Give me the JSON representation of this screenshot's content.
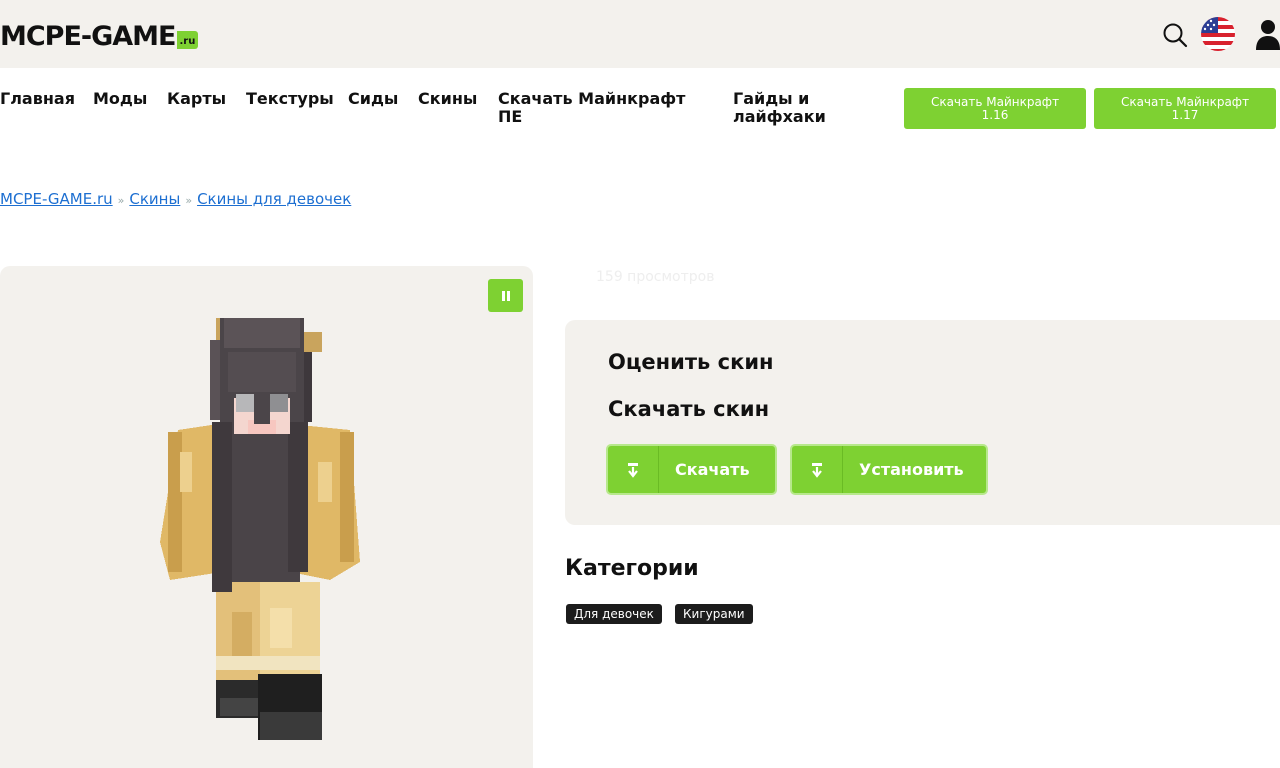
{
  "header": {
    "logo_text": "MCPE-GAME",
    "logo_suffix": ".ru",
    "icons": [
      "search-icon",
      "us-flag-icon",
      "user-icon"
    ]
  },
  "nav": {
    "items": [
      {
        "label": "Главная"
      },
      {
        "label": "Моды"
      },
      {
        "label": "Карты"
      },
      {
        "label": "Текстуры"
      },
      {
        "label": "Сиды"
      },
      {
        "label": "Скины"
      },
      {
        "label": "Скачать Майнкрафт\nПЕ"
      },
      {
        "label": "Гайды и\nлайфхаки"
      }
    ],
    "download_buttons": [
      {
        "label": "Скачать Майнкрафт\n1.16"
      },
      {
        "label": "Скачать Майнкрафт\n1.17"
      }
    ]
  },
  "breadcrumb": {
    "items": [
      "MCPE-GAME.ru",
      "Скины",
      "Скины для девочек"
    ],
    "separator": "»"
  },
  "skin": {
    "views": "159 просмотров"
  },
  "panel": {
    "rate_title": "Оценить скин",
    "download_title": "Скачать скин",
    "download_label": "Скачать",
    "install_label": "Установить"
  },
  "categories": {
    "title": "Категории",
    "tags": [
      "Для девочек",
      "Кигурами"
    ]
  },
  "colors": {
    "accent": "#7ed132",
    "panel_bg": "#f3f1ed",
    "link": "#1d6fd1",
    "tag_bg": "#1c1c1c"
  }
}
